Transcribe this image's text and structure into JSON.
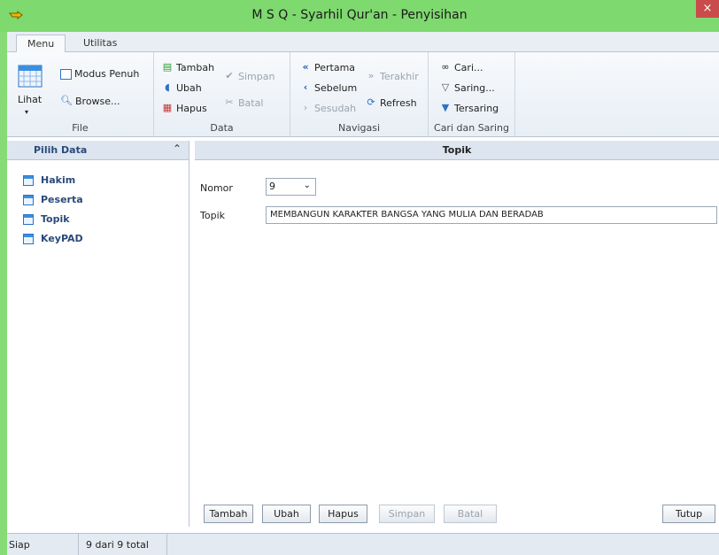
{
  "window": {
    "title": "M S Q - Syarhil Qur'an - Penyisihan",
    "close_glyph": "×"
  },
  "tabs": [
    "Menu",
    "Utilitas"
  ],
  "ribbon": {
    "file": {
      "label": "File",
      "lihat": "Lihat",
      "modus_penuh": "Modus Penuh",
      "browse": "Browse..."
    },
    "data": {
      "label": "Data",
      "tambah": "Tambah",
      "ubah": "Ubah",
      "hapus": "Hapus",
      "simpan": "Simpan",
      "batal": "Batal"
    },
    "navigasi": {
      "label": "Navigasi",
      "pertama": "Pertama",
      "sebelum": "Sebelum",
      "sesudah": "Sesudah",
      "terakhir": "Terakhir",
      "refresh": "Refresh"
    },
    "cari": {
      "label": "Cari dan Saring",
      "cari": "Cari...",
      "saring": "Saring...",
      "tersaring": "Tersaring"
    }
  },
  "left_pane": {
    "title": "Pilih Data",
    "items": [
      "Hakim",
      "Peserta",
      "Topik",
      "KeyPAD"
    ]
  },
  "form": {
    "title": "Topik",
    "nomor_label": "Nomor",
    "nomor_value": "9",
    "topik_label": "Topik",
    "topik_value": "MEMBANGUN KARAKTER BANGSA YANG MULIA DAN BERADAB"
  },
  "buttons": {
    "tambah": "Tambah",
    "ubah": "Ubah",
    "hapus": "Hapus",
    "simpan": "Simpan",
    "batal": "Batal",
    "tutup": "Tutup"
  },
  "status": {
    "state": "Siap",
    "count": "9 dari 9 total"
  }
}
